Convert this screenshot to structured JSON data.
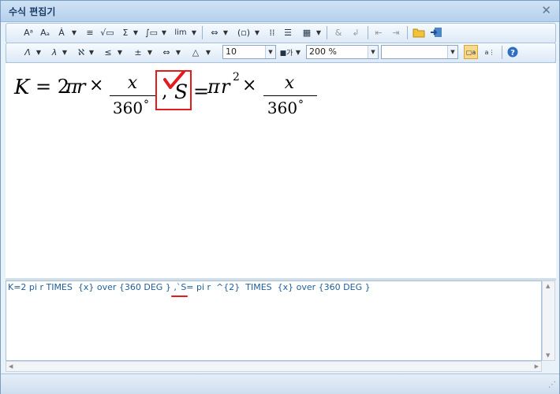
{
  "window": {
    "title": "수식 편집기",
    "close_glyph": "✕"
  },
  "toolbar1": {
    "buttons": [
      {
        "name": "superscript-button",
        "label": "Aᵃ",
        "dropdown": false
      },
      {
        "name": "subscript-button",
        "label": "Aₐ",
        "dropdown": false
      },
      {
        "name": "accent-button",
        "label": "Ȧ",
        "dropdown": true
      },
      {
        "name": "fraction-button",
        "label": "≡",
        "dropdown": false
      },
      {
        "name": "root-button",
        "label": "√▭",
        "dropdown": false
      },
      {
        "name": "sum-button",
        "label": "Σ",
        "dropdown": true
      },
      {
        "name": "integral-button",
        "label": "∫▭",
        "dropdown": true
      },
      {
        "name": "limit-button",
        "label": "lim",
        "dropdown": true
      },
      {
        "name": "arrow-layout-button",
        "label": "⇔",
        "dropdown": true
      },
      {
        "name": "bracket-button",
        "label": "(▫)",
        "dropdown": true
      },
      {
        "name": "matrix-button",
        "label": "⁞⁞",
        "dropdown": false
      },
      {
        "name": "align-button",
        "label": "☰",
        "dropdown": false
      },
      {
        "name": "grid-button",
        "label": "▦",
        "dropdown": true
      },
      {
        "name": "ampersand-button",
        "label": "&",
        "dropdown": false
      },
      {
        "name": "line-break-button",
        "label": "↲",
        "dropdown": false
      },
      {
        "name": "move-left-button",
        "label": "⇤",
        "dropdown": false
      },
      {
        "name": "move-right-button",
        "label": "⇥",
        "dropdown": false
      },
      {
        "name": "open-file-button",
        "label": "📂",
        "dropdown": false
      },
      {
        "name": "save-file-button",
        "label": "🖫",
        "dropdown": false
      }
    ]
  },
  "toolbar2": {
    "symbols": [
      {
        "name": "greek-upper-button",
        "label": "Λ"
      },
      {
        "name": "greek-lower-button",
        "label": "λ"
      },
      {
        "name": "hebrew-button",
        "label": "ℵ"
      },
      {
        "name": "relation-button",
        "label": "≤"
      },
      {
        "name": "operator-button",
        "label": "±"
      },
      {
        "name": "arrow-button",
        "label": "⇔"
      },
      {
        "name": "misc-symbol-button",
        "label": "△"
      }
    ],
    "font_size": "10",
    "color_label": "■가",
    "zoom": "200 %",
    "font_name": "",
    "icons": [
      {
        "name": "style-button",
        "label": "▢a"
      },
      {
        "name": "script-style-button",
        "label": "a⋮"
      },
      {
        "name": "help-button",
        "label": "?"
      }
    ]
  },
  "formula": {
    "K": "K",
    "eq1": "= 2",
    "pi": "π",
    "r": "r",
    "times": "×",
    "num": "x",
    "den": "360",
    "deg": "°",
    "comma": ",",
    "S": "S",
    "eq2": "=",
    "r2": "r",
    "sup2": "2",
    "checkmark": "✓"
  },
  "editor": {
    "text": "K=2 pi r TIMES  {x} over {360 DEG } ,`S= pi r  ^{2}  TIMES  {x} over {360 DEG }"
  },
  "colors": {
    "accent": "#e21c1c",
    "code": "#1e5e9a",
    "title": "#1d3e66"
  }
}
